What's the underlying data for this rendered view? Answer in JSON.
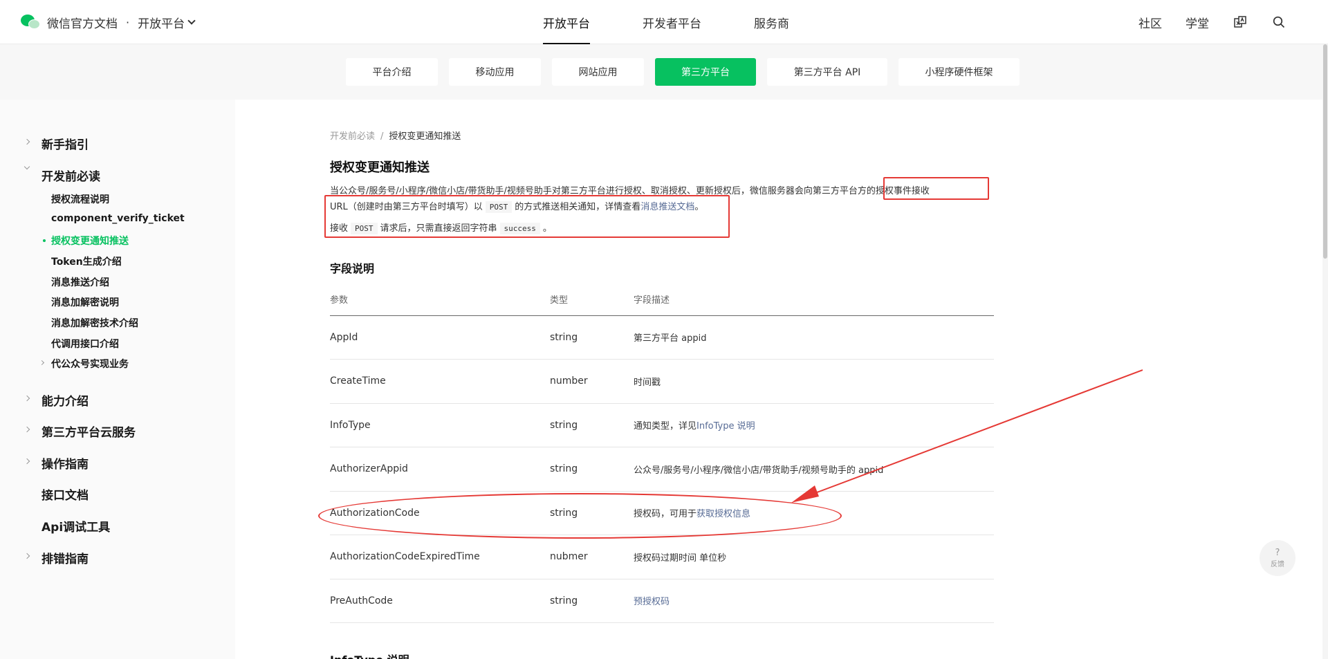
{
  "header": {
    "brand_title": "微信官方文档",
    "separator": "·",
    "platform_switch": "开放平台",
    "main_nav": [
      "开放平台",
      "开发者平台",
      "服务商"
    ],
    "right_nav": [
      "社区",
      "学堂"
    ]
  },
  "subnav": {
    "tabs": [
      "平台介绍",
      "移动应用",
      "网站应用",
      "第三方平台",
      "第三方平台 API",
      "小程序硬件框架"
    ],
    "active": "第三方平台"
  },
  "sidebar": {
    "items": {
      "s0": "新手指引",
      "s1": "开发前必读",
      "s1_children": {
        "c0": "授权流程说明",
        "c1": "component_verify_ticket",
        "c2": "授权变更通知推送",
        "c3": "Token生成介绍",
        "c4": "消息推送介绍",
        "c5": "消息加解密说明",
        "c6": "消息加解密技术介绍",
        "c7": "代调用接口介绍",
        "c8": "代公众号实现业务"
      },
      "s2": "能力介绍",
      "s3": "第三方平台云服务",
      "s4": "操作指南",
      "s5": "接口文档",
      "s6": "Api调试工具",
      "s7": "排错指南"
    }
  },
  "content": {
    "breadcrumb": {
      "parent": "开发前必读",
      "sep": "/",
      "current": "授权变更通知推送"
    },
    "title": "授权变更通知推送",
    "para1": "当公众号/服务号/小程序/微信小店/带货助手/视频号助手对第三方平台进行授权、取消授权、更新授权后，微信服务器会向第三方平台方的授权事件接收",
    "para2_a": "URL（创建时由第三方平台时填写）以",
    "para2_code": "POST",
    "para2_b": "的方式推送相关通知，详情查看",
    "para2_link": "消息推送文档",
    "para2_end": "。",
    "para3_a": "接收",
    "para3_code1": "POST",
    "para3_b": "请求后，只需直接返回字符串",
    "para3_code2": "success",
    "para3_end": "。",
    "fields_title": "字段说明",
    "table_headers": [
      "参数",
      "类型",
      "字段描述"
    ],
    "rows": {
      "r0": {
        "param": "AppId",
        "type": "string",
        "desc": "第三方平台 appid"
      },
      "r1": {
        "param": "CreateTime",
        "type": "number",
        "desc": "时间戳"
      },
      "r2": {
        "param": "InfoType",
        "type": "string",
        "desc": "通知类型，详见",
        "link": "InfoType 说明"
      },
      "r3": {
        "param": "AuthorizerAppid",
        "type": "string",
        "desc": "公众号/服务号/小程序/微信小店/带货助手/视频号助手的 appid"
      },
      "r4": {
        "param": "AuthorizationCode",
        "type": "string",
        "desc": "授权码，可用于",
        "link": "获取授权信息"
      },
      "r5": {
        "param": "AuthorizationCodeExpiredTime",
        "type": "nubmer",
        "desc": "授权码过期时间 单位秒"
      },
      "r6": {
        "param": "PreAuthCode",
        "type": "string",
        "desc": "",
        "link": "预授权码"
      }
    },
    "next_heading": "InfoType 说明"
  },
  "feedback": {
    "icon": "?",
    "label": "反馈"
  },
  "colors": {
    "brand": "#07c160",
    "link": "#576b95",
    "annotation": "#e53935"
  }
}
